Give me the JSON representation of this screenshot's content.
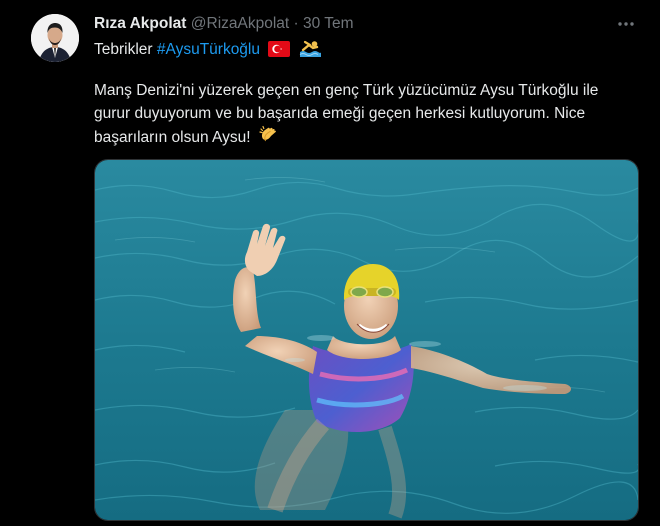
{
  "author": {
    "name": "Rıza Akpolat",
    "handle": "@RizaAkpolat",
    "separator": "·",
    "date": "30 Tem"
  },
  "tweet": {
    "prefix": "Tebrikler",
    "hashtag": "#AysuTürkoğlu",
    "body": "Manş Denizi'ni yüzerek geçen en genç Türk yüzücümüz Aysu Türkoğlu ile gurur duyuyorum ve bu başarıda emeği geçen herkesi kutluyorum. Nice başarıların olsun Aysu!",
    "emojis": [
      "turkish-flag",
      "swimmer",
      "clapping-hands"
    ]
  },
  "media": {
    "icon": "swimmer-photo"
  },
  "icons": [
    "avatar",
    "more-icon"
  ],
  "colors": {
    "background": "#000000",
    "text": "#e7e9ea",
    "muted": "#71767b",
    "link": "#1d9bf0",
    "sea": "#1f7d93"
  }
}
